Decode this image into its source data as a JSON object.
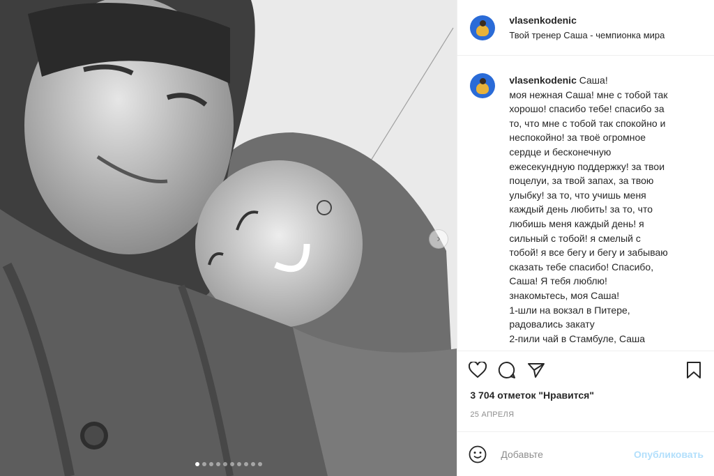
{
  "post": {
    "username": "vlasenkodenic",
    "location": "Твой тренер Саша - чемпионка мира",
    "caption_first": "Саша!",
    "caption_lines": [
      "моя нежная Саша! мне с тобой так",
      "хорошо! спасибо тебе! спасибо за",
      "то, что мне с тобой так спокойно и",
      "неспокойно! за твоё огромное",
      "сердце и бесконечную",
      "ежесекундную поддержку! за твои",
      "поцелуи, за твой запах, за твою",
      "улыбку! за то, что учишь меня",
      "каждый день любить! за то, что",
      "любишь меня каждый день! я",
      "сильный с тобой! я смелый с",
      "тобой! я все бегу и бегу и забываю",
      "сказать тебе спасибо! Спасибо,",
      "Саша! Я тебя люблю!",
      "знакомьтесь, моя Саша!",
      "1-шли на вокзал в Питере,",
      "радовались закату",
      "2-пили чай в Стамбуле, Саша"
    ],
    "likes": "3 704 отметок \"Нравится\"",
    "date": "25 АПРЕЛЯ"
  },
  "carousel": {
    "total_slides": 10,
    "active_slide": 1
  },
  "comment": {
    "placeholder": "Добавьте",
    "publish_label": "Опубликовать"
  },
  "icons": {
    "like": "heart-icon",
    "comment": "comment-icon",
    "share": "send-icon",
    "save": "bookmark-icon",
    "emoji": "smiley-icon",
    "next": "chevron-right-icon"
  },
  "colors": {
    "text": "#262626",
    "muted": "#8e8e8e",
    "publish": "#b2dffc",
    "divider": "#efefef"
  }
}
